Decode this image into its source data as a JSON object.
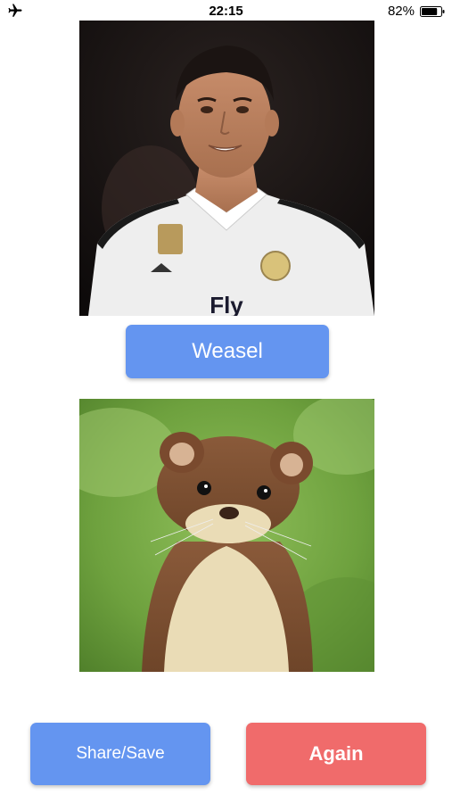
{
  "status_bar": {
    "time": "22:15",
    "battery_percent": "82%",
    "battery_level": 0.82,
    "airplane_icon": "airplane-icon"
  },
  "photos": {
    "person": {
      "jersey_text": "Fly"
    },
    "animal": {}
  },
  "buttons": {
    "result_label": "Weasel",
    "share_label": "Share/Save",
    "again_label": "Again"
  },
  "colors": {
    "primary_button": "#6495f0",
    "again_button": "#f06b6b",
    "background": "#ffffff"
  }
}
